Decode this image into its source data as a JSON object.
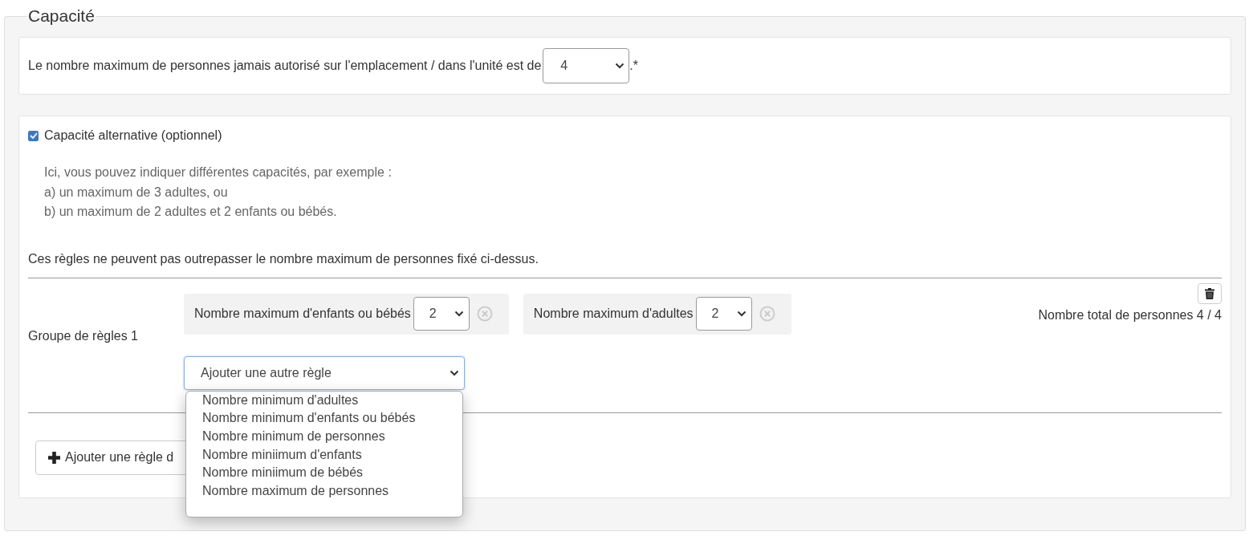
{
  "legend": "Capacité",
  "max_capacity": {
    "label": "Le nombre maximum de personnes jamais autorisé sur l'emplacement / dans l'unité est de",
    "value": "4",
    "suffix": ".*"
  },
  "alternative": {
    "checked": true,
    "label": "Capacité alternative (optionnel)",
    "help_lines": [
      "Ici, vous pouvez indiquer différentes capacités, par exemple :",
      "a) un maximum de 3 adultes, ou",
      "b) un maximum de 2 adultes et 2 enfants ou bébés."
    ],
    "note": "Ces règles ne peuvent pas outrepasser le nombre maximum de personnes fixé ci-dessus.",
    "rule_groups": [
      {
        "label": "Groupe de règles 1",
        "total": "Nombre total de personnes 4 / 4",
        "rules": [
          {
            "label": "Nombre maximum d'enfants ou bébés",
            "value": "2"
          },
          {
            "label": "Nombre maximum d'adultes",
            "value": "2"
          }
        ],
        "add_rule": {
          "value": "Ajouter une autre règle",
          "expanded": true,
          "options": [
            "Nombre minimum d'adultes",
            "Nombre minimum d'enfants ou bébés",
            "Nombre minimum de personnes",
            "Nombre miniimum d'enfants",
            "Nombre miniimum de bébés",
            "Nombre maximum de personnes"
          ]
        }
      }
    ],
    "add_group_button": "Ajouter une règle d"
  }
}
